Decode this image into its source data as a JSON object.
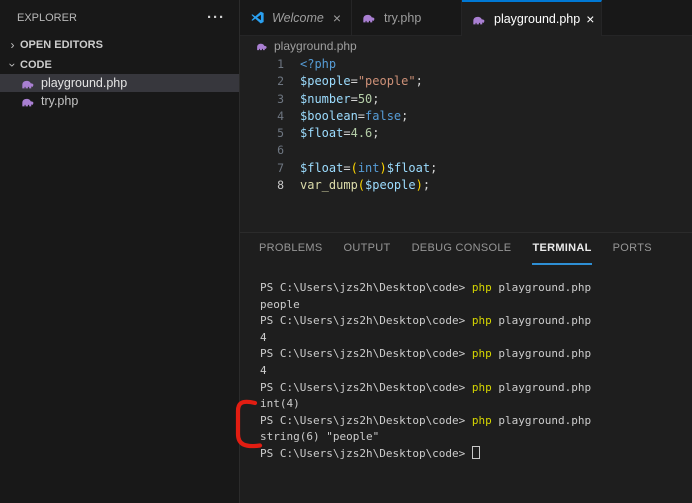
{
  "colors": {
    "accent_blue": "#0078d4",
    "annotation_red": "#e21d12",
    "terminal_command_yellow": "#d6d600",
    "selected_row_bg": "#37373d"
  },
  "sidebar": {
    "title": "EXPLORER",
    "more_icon": "···",
    "sections": [
      {
        "label": "OPEN EDITORS",
        "chevron": "›",
        "expanded": false
      },
      {
        "label": "CODE",
        "chevron": "›",
        "expanded": true
      }
    ],
    "files": [
      {
        "name": "playground.php",
        "selected": true
      },
      {
        "name": "try.php",
        "selected": false
      }
    ]
  },
  "tabs": [
    {
      "label": "Welcome",
      "icon": "vscode-logo",
      "close": "×",
      "active": false,
      "preview": true
    },
    {
      "label": "try.php",
      "icon": "php-elephant",
      "active": false
    },
    {
      "label": "playground.php",
      "icon": "php-elephant",
      "close": "×",
      "active": true
    }
  ],
  "breadcrumb": {
    "file": "playground.php"
  },
  "editor": {
    "lines": [
      {
        "num": "1",
        "tokens": [
          {
            "text": "<?php",
            "color": "kw"
          }
        ]
      },
      {
        "num": "2",
        "tokens": [
          {
            "text": "$people",
            "color": "var"
          },
          {
            "text": "=",
            "color": "op"
          },
          {
            "text": "\"people\"",
            "color": "str"
          },
          {
            "text": ";",
            "color": "op"
          }
        ]
      },
      {
        "num": "3",
        "tokens": [
          {
            "text": "$number",
            "color": "var"
          },
          {
            "text": "=",
            "color": "op"
          },
          {
            "text": "50",
            "color": "num"
          },
          {
            "text": ";",
            "color": "op"
          }
        ]
      },
      {
        "num": "4",
        "tokens": [
          {
            "text": "$boolean",
            "color": "var"
          },
          {
            "text": "=",
            "color": "op"
          },
          {
            "text": "false",
            "color": "kw"
          },
          {
            "text": ";",
            "color": "op"
          }
        ]
      },
      {
        "num": "5",
        "tokens": [
          {
            "text": "$float",
            "color": "var"
          },
          {
            "text": "=",
            "color": "op"
          },
          {
            "text": "4.6",
            "color": "num"
          },
          {
            "text": ";",
            "color": "op"
          }
        ]
      },
      {
        "num": "6",
        "tokens": []
      },
      {
        "num": "7",
        "tokens": [
          {
            "text": "$float",
            "color": "var"
          },
          {
            "text": "=",
            "color": "op"
          },
          {
            "text": "(",
            "color": "paren"
          },
          {
            "text": "int",
            "color": "kw"
          },
          {
            "text": ")",
            "color": "paren"
          },
          {
            "text": "$float",
            "color": "var"
          },
          {
            "text": ";",
            "color": "op"
          }
        ]
      },
      {
        "num": "8",
        "current": true,
        "tokens": [
          {
            "text": "var_dump",
            "color": "fn"
          },
          {
            "text": "(",
            "color": "paren"
          },
          {
            "text": "$people",
            "color": "var"
          },
          {
            "text": ")",
            "color": "paren"
          },
          {
            "text": ";",
            "color": "op"
          }
        ]
      }
    ]
  },
  "panel": {
    "tabs": [
      {
        "label": "PROBLEMS",
        "active": false
      },
      {
        "label": "OUTPUT",
        "active": false
      },
      {
        "label": "DEBUG CONSOLE",
        "active": false
      },
      {
        "label": "TERMINAL",
        "active": true
      },
      {
        "label": "PORTS",
        "active": false
      }
    ],
    "terminal": {
      "prompt": "PS C:\\Users\\jzs2h\\Desktop\\code>",
      "command_exe": "php",
      "command_arg": "playground.php",
      "lines": [
        {
          "type": "cmd"
        },
        {
          "type": "out",
          "text": "people"
        },
        {
          "type": "cmd"
        },
        {
          "type": "out",
          "text": "4"
        },
        {
          "type": "cmd"
        },
        {
          "type": "out",
          "text": "4"
        },
        {
          "type": "cmd"
        },
        {
          "type": "out",
          "text": "int(4)"
        },
        {
          "type": "cmd"
        },
        {
          "type": "out",
          "text": "string(6) \"people\""
        },
        {
          "type": "cursor"
        }
      ]
    }
  }
}
